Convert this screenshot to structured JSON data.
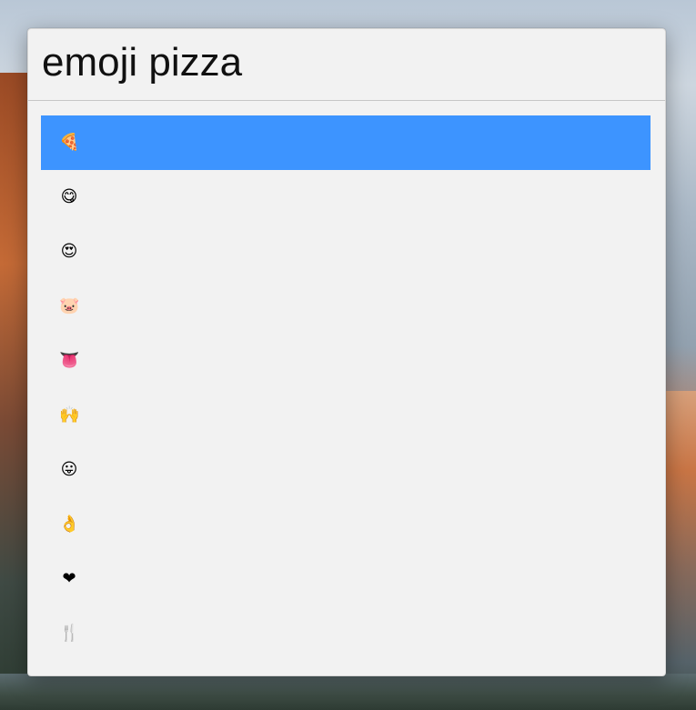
{
  "search": {
    "query": "emoji pizza"
  },
  "results": [
    {
      "emoji": "🍕",
      "icon": "pizza-icon",
      "selected": true
    },
    {
      "emoji": "😋",
      "icon": "yum-face-icon",
      "selected": false
    },
    {
      "emoji": "😍",
      "icon": "heart-eyes-face-icon",
      "selected": false
    },
    {
      "emoji": "🐷",
      "icon": "pig-face-icon",
      "selected": false
    },
    {
      "emoji": "👅",
      "icon": "tongue-icon",
      "selected": false
    },
    {
      "emoji": "🙌",
      "icon": "raised-hands-icon",
      "selected": false
    },
    {
      "emoji": "😛",
      "icon": "tongue-out-face-icon",
      "selected": false
    },
    {
      "emoji": "👌",
      "icon": "ok-hand-icon",
      "selected": false
    },
    {
      "emoji": "❤",
      "icon": "heart-icon",
      "selected": false
    },
    {
      "emoji": "🍴",
      "icon": "fork-and-knife-icon",
      "selected": false
    }
  ],
  "colors": {
    "selection": "#3d94ff",
    "panel": "#f2f2f2",
    "divider": "#c6c6c6"
  }
}
